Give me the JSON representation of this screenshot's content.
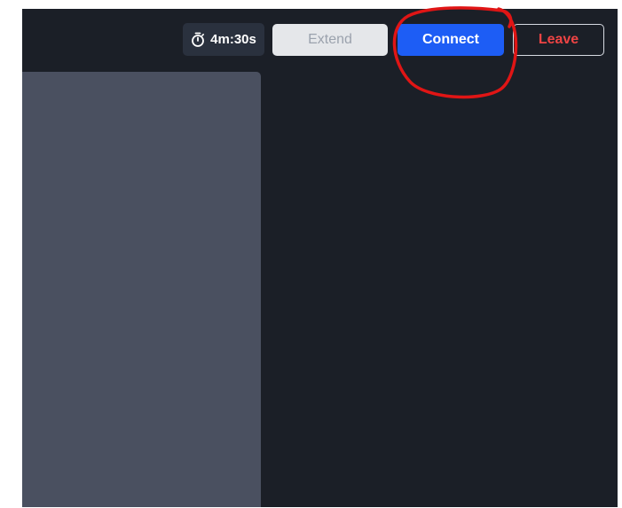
{
  "header": {
    "timer": {
      "icon": "stopwatch-icon",
      "value": "4m:30s"
    },
    "buttons": {
      "extend_label": "Extend",
      "connect_label": "Connect",
      "leave_label": "Leave"
    }
  },
  "colors": {
    "background": "#1b1f27",
    "side_panel": "#4a5060",
    "timer_bg": "#2a313e",
    "extend_bg": "#e5e7ea",
    "extend_text": "#9ba2ad",
    "connect_bg": "#1d5df5",
    "leave_text": "#ef4444",
    "annotation": "#e01515"
  }
}
